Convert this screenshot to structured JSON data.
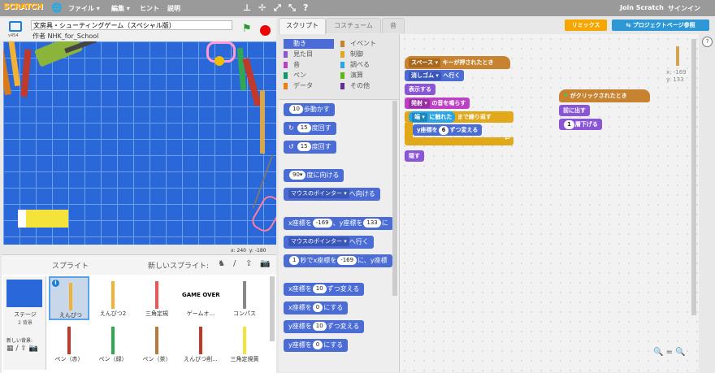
{
  "menubar": {
    "logo": "SCRATCH",
    "file": "ファイル ▾",
    "edit": "編集 ▾",
    "hint": "ヒント",
    "about": "説明",
    "join": "Join Scratch",
    "signin": "サインイン"
  },
  "stage_header": {
    "version": "v454",
    "title": "文房具・シューティングゲーム（スペシャル版）",
    "author": "作者 NHK_for_School"
  },
  "stage_coords": {
    "x_label": "x:",
    "x": "240",
    "y_label": "y:",
    "y": "-180"
  },
  "sprites_panel": {
    "label": "スプライト",
    "new_sprite": "新しいスプライト:",
    "stage_label": "ステージ",
    "stage_backdrops": "2 背景",
    "new_backdrop": "新しい背景:",
    "sprites": [
      {
        "name": "えんぴつ",
        "selected": true
      },
      {
        "name": "えんぴつ2"
      },
      {
        "name": "三角定規"
      },
      {
        "name": "ゲームオ...",
        "pic_text": "GAME OVER"
      },
      {
        "name": "コンパス"
      },
      {
        "name": "ペン（赤）"
      },
      {
        "name": "ペン（緑）"
      },
      {
        "name": "ペン（茶）"
      },
      {
        "name": "えんぴつ削..."
      },
      {
        "name": "三角定規黄"
      }
    ]
  },
  "tabs": [
    "スクリプト",
    "コスチューム",
    "音"
  ],
  "buttons": {
    "remix": "リミックス",
    "project_page": "プロジェクトページ参照"
  },
  "categories": [
    {
      "label": "動き",
      "color": "#4a6cd4",
      "active": true
    },
    {
      "label": "見た目",
      "color": "#8a55d7"
    },
    {
      "label": "音",
      "color": "#bb42c3"
    },
    {
      "label": "ペン",
      "color": "#0e9a6c"
    },
    {
      "label": "データ",
      "color": "#ee7d16"
    },
    {
      "label": "イベント",
      "color": "#c88330"
    },
    {
      "label": "制御",
      "color": "#e1a91a"
    },
    {
      "label": "調べる",
      "color": "#2ca5e2"
    },
    {
      "label": "演算",
      "color": "#5cb712"
    },
    {
      "label": "その他",
      "color": "#632d99"
    }
  ],
  "palette_blocks": {
    "move": {
      "n": "10",
      "t": "歩動かす"
    },
    "turn_right": {
      "n": "15",
      "t": "度回す"
    },
    "turn_left": {
      "n": "15",
      "t": "度回す"
    },
    "point_dir": {
      "n": "90▾",
      "t": "度に向ける"
    },
    "point_towards": {
      "t": "へ向ける",
      "dd": "マウスのポインター ▾"
    },
    "goto_xy": {
      "a": "x座標を",
      "x": "-169",
      "b": "、y座標を",
      "y": "133",
      "c": "に"
    },
    "goto": {
      "t": "へ行く",
      "dd": "マウスのポインター ▾"
    },
    "glide": {
      "n": "1",
      "a": "秒でx座標を",
      "x": "-169",
      "b": "に、y座標"
    },
    "change_x": {
      "a": "x座標を",
      "n": "10",
      "b": "ずつ変える"
    },
    "set_x": {
      "a": "x座標を",
      "n": "0",
      "b": "にする"
    },
    "change_y": {
      "a": "y座標を",
      "n": "10",
      "b": "ずつ変える"
    },
    "set_y": {
      "a": "y座標を",
      "n": "0",
      "b": "にする"
    }
  },
  "script1": {
    "hat_key": "スペース ▾",
    "hat_text": "キーが押されたとき",
    "goto_dd": "消しゴム ▾",
    "goto_text": "へ行く",
    "show": "表示する",
    "sound_dd": "発射 ▾",
    "sound_text": "の音を鳴らす",
    "repeat_dd": "端 ▾",
    "repeat_mid": "に触れた",
    "repeat_text": "まで繰り返す",
    "change_y_a": "y座標を",
    "change_y_n": "6",
    "change_y_b": "ずつ変える",
    "hide": "隠す"
  },
  "script2": {
    "hat_text": "がクリックされたとき",
    "front": "前に出す",
    "back_n": "1",
    "back_text": "層下げる"
  },
  "sprite_info": {
    "x": "x: -169",
    "y": "y: 133"
  },
  "zoom": {
    "out": "🔍",
    "reset": "=",
    "in": "🔍"
  }
}
